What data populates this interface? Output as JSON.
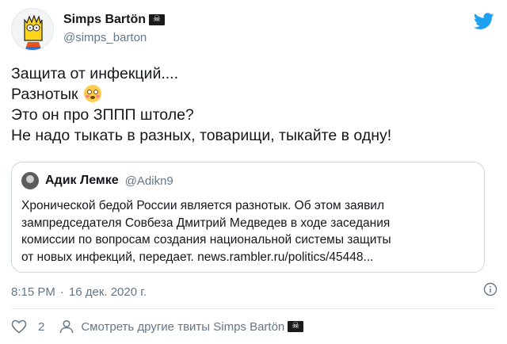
{
  "author": {
    "display_name": "Simps Bartön",
    "handle": "@simps_barton"
  },
  "tweet": {
    "lines": [
      "Защита от инфекций....",
      "Разнотык",
      "Это он про ЗППП штоле?",
      "Не надо тыкать в разных, товарищи, тыкайте в одну!"
    ]
  },
  "quoted": {
    "display_name": "Адик Лемке",
    "handle": "@Adikn9",
    "lines": [
      "Хронической бедой России является разнотык. Об этом заявил",
      "зампредседателя Совбеза Дмитрий Медведев в ходе заседания",
      "комиссии по вопросам создания национальной системы защиты",
      "от новых инфекций, передает. news.rambler.ru/politics/45448..."
    ]
  },
  "meta": {
    "time": "8:15 PM",
    "separator": "·",
    "date": "16 дек. 2020 г."
  },
  "footer": {
    "like_count": "2",
    "more_tweets_label": "Смотреть другие твиты Simps Bartön"
  },
  "colors": {
    "twitter_blue": "#1da1f2",
    "secondary_text": "#657786",
    "border": "#ccd6dd"
  },
  "icons": [
    "twitter-bird-icon",
    "flushed-face-emoji",
    "info-icon",
    "heart-icon",
    "user-icon",
    "pirate-flag-icon"
  ]
}
